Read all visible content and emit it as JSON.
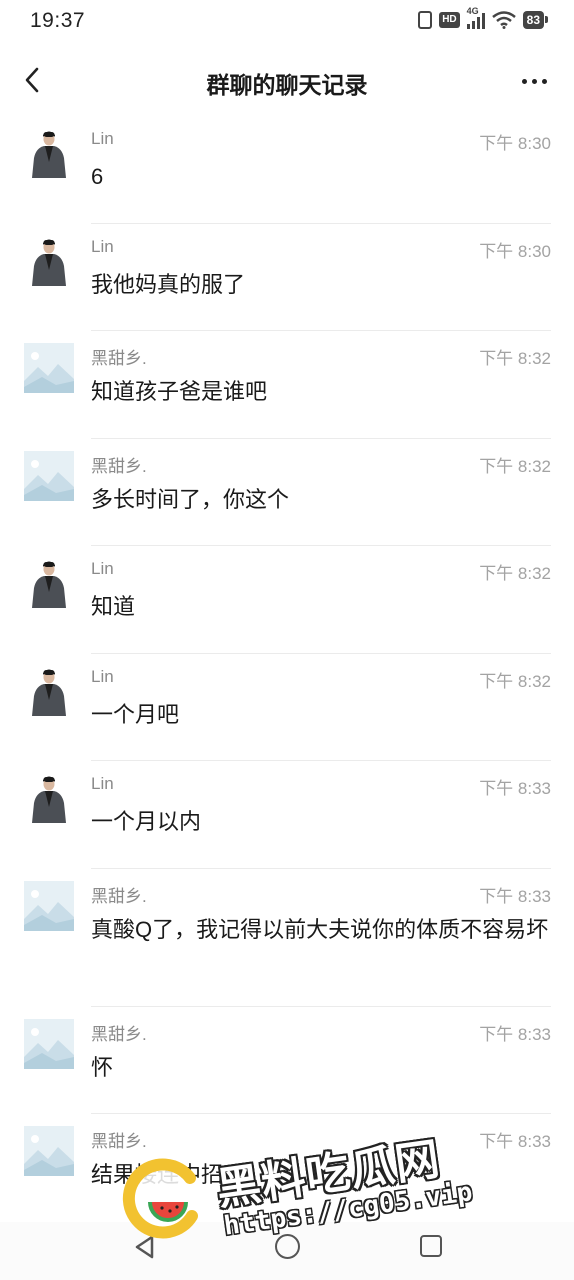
{
  "status_bar": {
    "time": "19:37",
    "hd_badge": "HD",
    "network": "4G",
    "battery": "83",
    "icons": [
      "vibrate-icon",
      "hd-icon",
      "signal-4g-icon",
      "wifi-icon",
      "battery-icon"
    ]
  },
  "header": {
    "title": "群聊的聊天记录",
    "back_icon": "chevron-left-icon",
    "more_icon": "more-dots-icon"
  },
  "messages": [
    {
      "sender": "Lin",
      "time": "下午 8:30",
      "text": "6",
      "avatar": "lin-photo"
    },
    {
      "sender": "Lin",
      "time": "下午 8:30",
      "text": "我他妈真的服了",
      "avatar": "lin-photo"
    },
    {
      "sender": "黑甜乡.",
      "time": "下午 8:32",
      "text": "知道孩子爸是谁吧",
      "avatar": "placeholder-image"
    },
    {
      "sender": "黑甜乡.",
      "time": "下午 8:32",
      "text": "多长时间了，你这个",
      "avatar": "placeholder-image"
    },
    {
      "sender": "Lin",
      "time": "下午 8:32",
      "text": "知道",
      "avatar": "lin-photo"
    },
    {
      "sender": "Lin",
      "time": "下午 8:32",
      "text": "一个月吧",
      "avatar": "lin-photo"
    },
    {
      "sender": "Lin",
      "time": "下午 8:33",
      "text": "一个月以内",
      "avatar": "lin-photo"
    },
    {
      "sender": "黑甜乡.",
      "time": "下午 8:33",
      "text": "真酸Q了，我记得以前大夫说你的体质不容易坏",
      "avatar": "placeholder-image"
    },
    {
      "sender": "黑甜乡.",
      "time": "下午 8:33",
      "text": "怀",
      "avatar": "placeholder-image"
    },
    {
      "sender": "黑甜乡.",
      "time": "下午 8:33",
      "text": "结果接连中招",
      "avatar": "placeholder-image"
    }
  ],
  "bottom_nav": {
    "icons": [
      "nav-back-icon",
      "nav-home-icon",
      "nav-recents-icon"
    ]
  },
  "watermark": {
    "title": "黑料吃瓜网",
    "url": "https://cg05.vip"
  },
  "colors": {
    "text_primary": "#1a1a1a",
    "text_secondary": "#8a8a8a",
    "divider": "#ebebeb",
    "placeholder_bg": "#e6f0f5",
    "watermark_ring": "#f2c230",
    "watermark_melon": "#e8453c"
  }
}
